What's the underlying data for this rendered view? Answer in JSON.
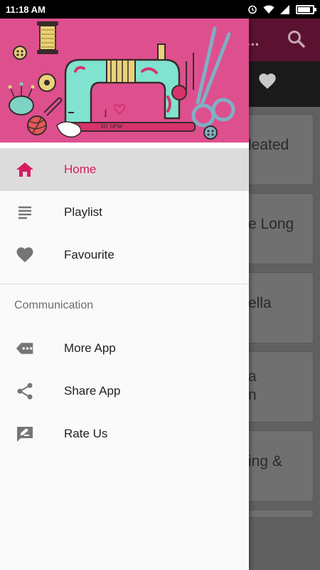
{
  "status_bar": {
    "time": "11:18 AM"
  },
  "background_app": {
    "title": "i...",
    "cards": [
      {
        "text": "leated"
      },
      {
        "text": "e Long"
      },
      {
        "text": "ella"
      },
      {
        "text": "a\nn"
      },
      {
        "text": "ing &"
      }
    ]
  },
  "drawer": {
    "header": {
      "badge_line1": "I",
      "badge_line2": "to sew"
    },
    "main_items": [
      {
        "label": "Home",
        "icon": "home-icon"
      },
      {
        "label": "Playlist",
        "icon": "playlist-icon"
      },
      {
        "label": "Favourite",
        "icon": "heart-icon"
      }
    ],
    "section_title": "Communication",
    "comm_items": [
      {
        "label": "More App",
        "icon": "more-app-icon"
      },
      {
        "label": "Share App",
        "icon": "share-icon"
      },
      {
        "label": "Rate Us",
        "icon": "rate-icon"
      }
    ]
  },
  "colors": {
    "accent": "#d81b60",
    "header_bg": "#de4f8e",
    "icon_gray": "#757575"
  }
}
